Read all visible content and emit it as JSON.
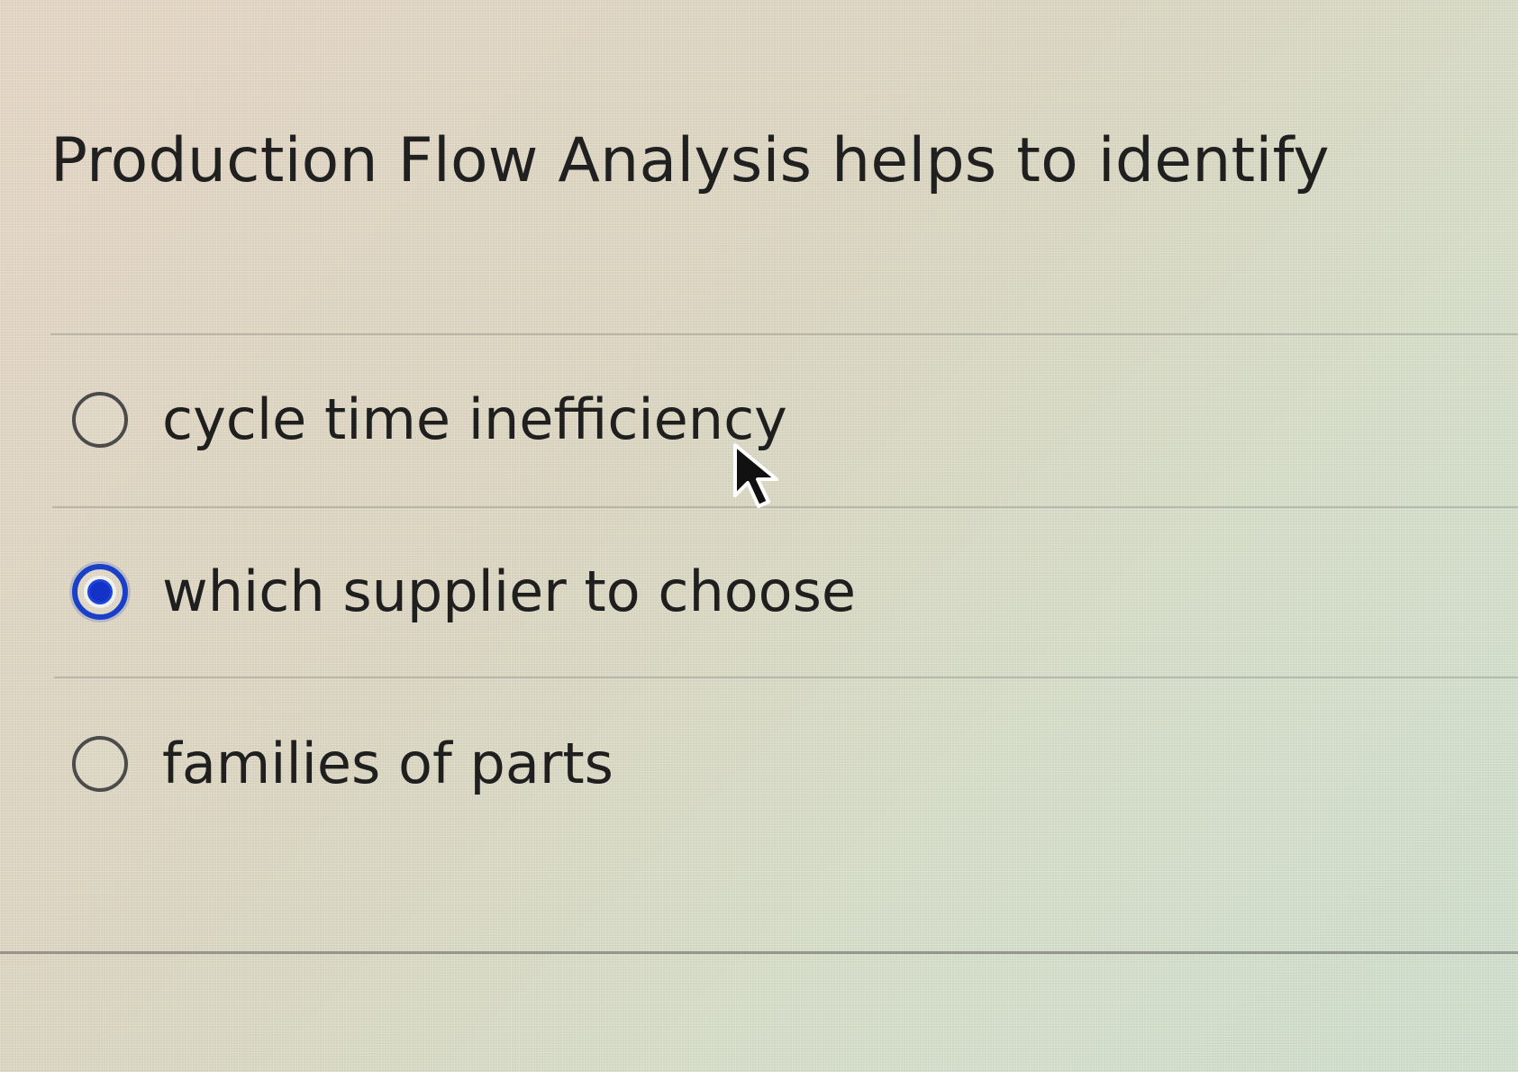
{
  "question": {
    "text": "Production Flow Analysis helps to identify"
  },
  "options": [
    {
      "label": "cycle time inefficiency",
      "selected": false
    },
    {
      "label": "which supplier to choose",
      "selected": true
    },
    {
      "label": "families of parts",
      "selected": false
    }
  ],
  "colors": {
    "selected_radio": "#1a3fc8",
    "text": "#1f1f1f",
    "unselected_radio": "#4b4b4b"
  },
  "icons": {
    "cursor": "mouse-pointer-icon"
  }
}
